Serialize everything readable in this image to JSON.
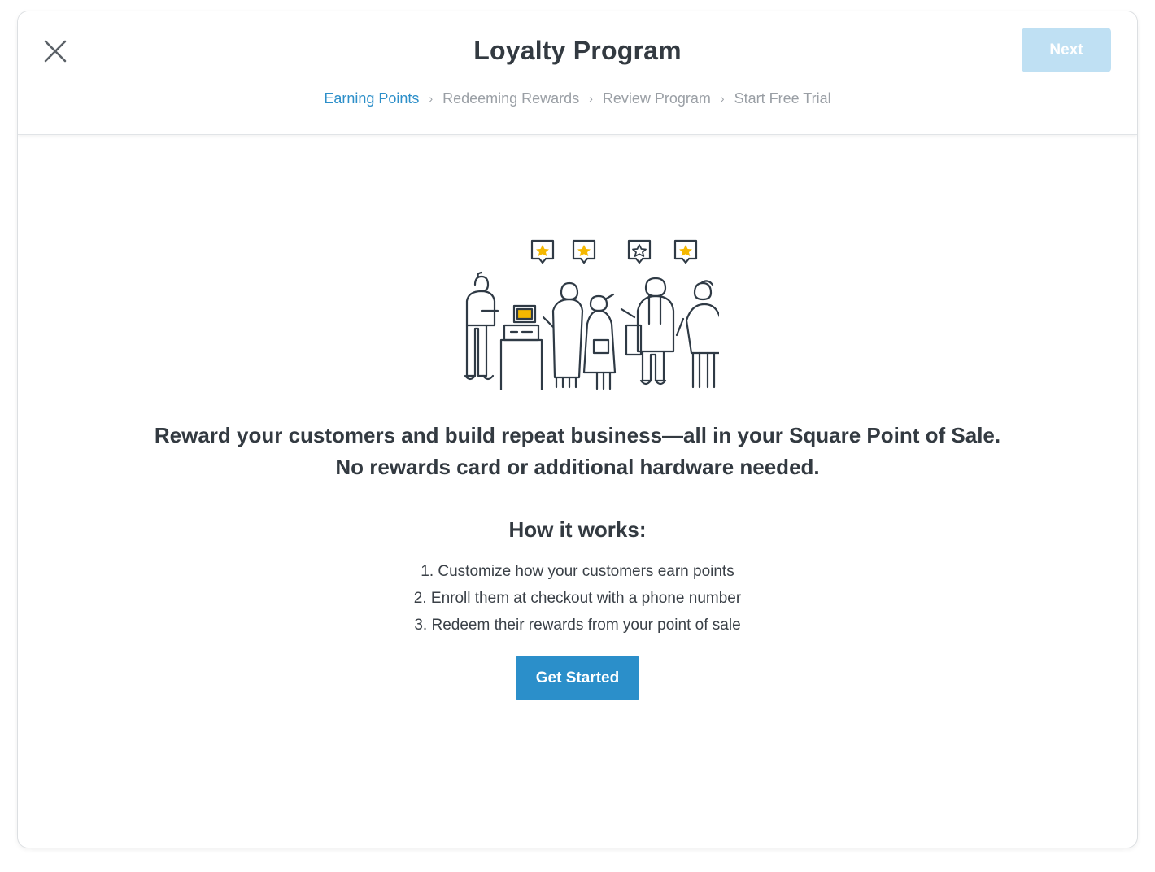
{
  "header": {
    "title": "Loyalty Program",
    "next_label": "Next",
    "close_icon": "close-icon"
  },
  "breadcrumb": [
    {
      "label": "Earning Points",
      "active": true
    },
    {
      "label": "Redeeming Rewards",
      "active": false
    },
    {
      "label": "Review Program",
      "active": false
    },
    {
      "label": "Start Free Trial",
      "active": false
    }
  ],
  "main": {
    "illustration_icon": "customers-at-checkout-illustration",
    "headline_line1": "Reward your customers and build repeat business—all in your Square Point of Sale.",
    "headline_line2": "No rewards card or additional hardware needed.",
    "how_title": "How it works:",
    "steps": [
      "1. Customize how your customers earn points",
      "2. Enroll them at checkout with a phone number",
      "3. Redeem their rewards from your point of sale"
    ],
    "cta_label": "Get Started"
  },
  "colors": {
    "accent": "#2b8fca",
    "accent_disabled": "#bfe0f3",
    "star": "#f5b800",
    "text": "#333a41",
    "muted": "#9a9fa5"
  }
}
